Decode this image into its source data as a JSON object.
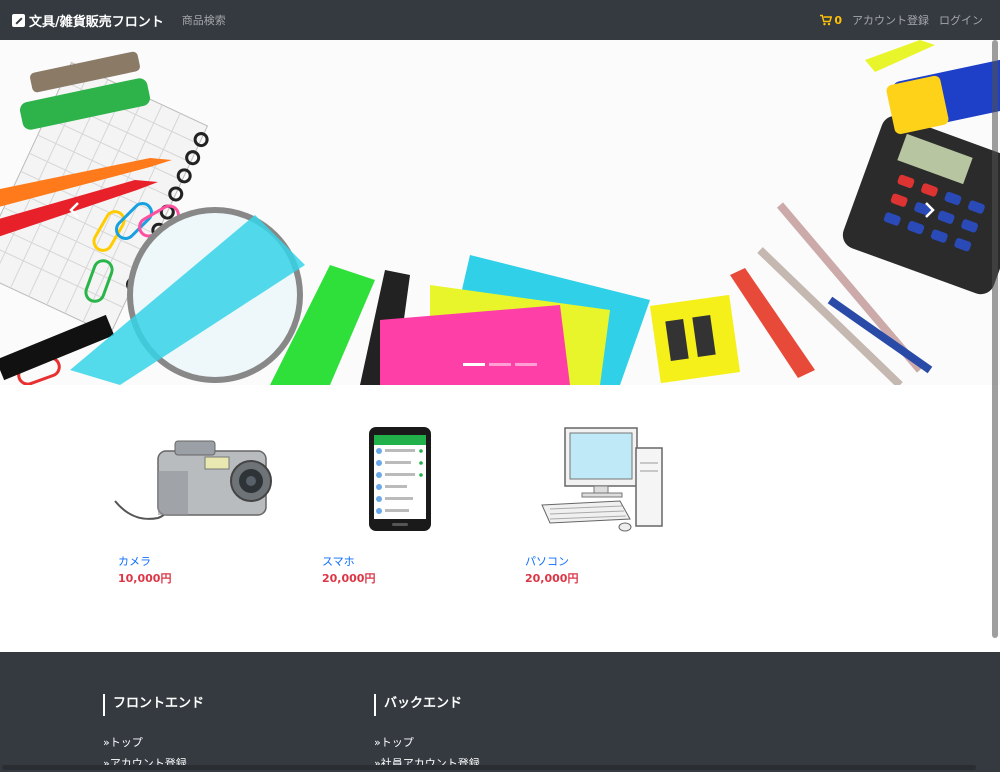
{
  "navbar": {
    "brand": "文具/雑貨販売フロント",
    "search_link": "商品検索",
    "cart_count": "0",
    "register_link": "アカウント登録",
    "login_link": "ログイン"
  },
  "carousel": {
    "slide_count": 3,
    "active_index": 0
  },
  "products": [
    {
      "name": "カメラ",
      "price": "10,000円"
    },
    {
      "name": "スマホ",
      "price": "20,000円"
    },
    {
      "name": "パソコン",
      "price": "20,000円"
    }
  ],
  "footer": {
    "columns": [
      {
        "heading": "フロントエンド",
        "links": [
          "»トップ",
          "»アカウント登録"
        ]
      },
      {
        "heading": "バックエンド",
        "links": [
          "»トップ",
          "»社員アカウント登録"
        ]
      }
    ]
  },
  "colors": {
    "navbar_bg": "#343a40",
    "cart": "#ffc107",
    "product_link": "#0d6efd",
    "price": "#dc3545"
  }
}
